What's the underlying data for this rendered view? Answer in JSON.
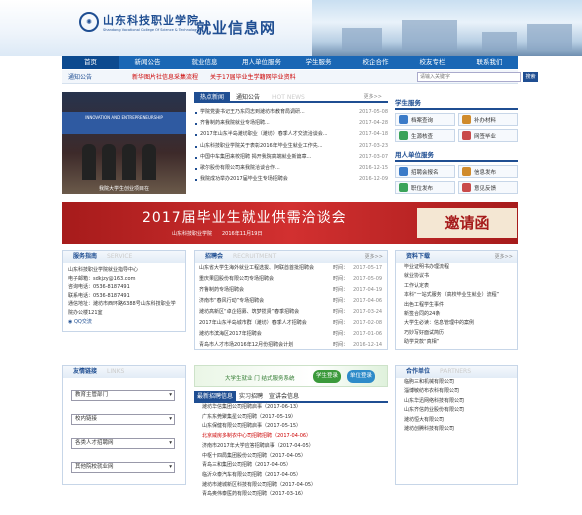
{
  "header": {
    "seal": "✺",
    "cn_name": "山东科技职业学院",
    "en_name": "Shandong Vocational College Of Science & Technology",
    "site_title": "就业信息网"
  },
  "nav": [
    "首页",
    "新闻公告",
    "就业信息",
    "用人单位服务",
    "学生服务",
    "校企合作",
    "校友专栏",
    "联系我们"
  ],
  "notice": {
    "label": "通知公告",
    "msg1": "新华图片社信息采集流程",
    "msg2": "关于17届毕业生学籍网毕业资料",
    "search_placeholder": "请输入关键字",
    "search_btn": "搜索"
  },
  "photo": {
    "band": "INNOVATION AND ENTREPRENEURSHIP",
    "caption": "我院大学生创业项目在"
  },
  "news": {
    "tabs": [
      "热点新闻",
      "通知公告",
      "HOT NEWS"
    ],
    "more": "更多>>",
    "items": [
      {
        "t": "学院党委书记王乃东同志到潍坊市教育局调研...",
        "d": "2017-05-08"
      },
      {
        "t": "齐鲁制药来我院就业专场招聘...",
        "d": "2017-04-28"
      },
      {
        "t": "2017年山东半岛潍坊职业（潍坊）春季人才交流洽谈会...",
        "d": "2017-04-18"
      },
      {
        "t": "山东科技职业学院关于表彰2016年毕业生就业工作先...",
        "d": "2017-03-23"
      },
      {
        "t": "中国中车集团来校招聘 揭开我院高端就业新篇章...",
        "d": "2017-03-07"
      },
      {
        "t": "歌尔股份有限公司来我院洽谈合作...",
        "d": "2016-12-15"
      },
      {
        "t": "我院成功举办2017届毕业生专场招聘会",
        "d": "2016-12-09"
      }
    ]
  },
  "services": {
    "student_title": "学生服务",
    "student": [
      "档案查询",
      "补办材料",
      "生源核查",
      "网签毕业"
    ],
    "employer_title": "用人单位服务",
    "employer": [
      "招聘会报名",
      "信息发布",
      "职位发布",
      "意见反馈"
    ]
  },
  "banner": {
    "title": "2017届毕业生就业供需洽谈会",
    "sub": "山东科技职业学院　　2016年11月19日",
    "invite": "邀请函"
  },
  "guide": {
    "title": "服务指南",
    "ghost": "SERVICE",
    "lines": [
      "山东科技职业学院就业指导中心",
      "电子邮箱：sdkjzy@163.com",
      "咨询电话：0536-8187491",
      "联系电话：0536-8187491",
      "通信地址：潍坊市西环路6388号山东科技职业学院办公楼121室"
    ],
    "qq": "QQ交流"
  },
  "recruit": {
    "title": "招聘会",
    "ghost": "RECRUITMENT",
    "more": "更多>>",
    "items": [
      {
        "t": "山东省大学生海外就业工程选拔、阿联酋首批招聘会",
        "d": "2017-05-17"
      },
      {
        "t": "重庆果园股份有限公司专场招聘会",
        "d": "2017-05-09"
      },
      {
        "t": "齐鲁制药专场招聘会",
        "d": "2017-04-19"
      },
      {
        "t": "济南市“春风行动”专场招聘会",
        "d": "2017-04-06"
      },
      {
        "t": "潍坊高新区“卓企招募、筑梦揽贤”春季招聘会",
        "d": "2017-03-24"
      },
      {
        "t": "2017年山东半岛城市群（潍坊）春季人才招聘会",
        "d": "2017-02-08"
      },
      {
        "t": "潍坊市滨海区2017年招聘会",
        "d": "2017-01-06"
      },
      {
        "t": "青岛市人才市场2016年12月份招聘会计划",
        "d": "2016-12-14"
      }
    ],
    "label_t": "时间："
  },
  "materials": {
    "title": "资料下载",
    "more": "更多>>",
    "items": [
      "毕业证明书办理流程",
      "就业协议书",
      "工作认定表",
      "本科“一站式服务（高校毕业生就业）流程”",
      "出色工程学生事件",
      "新签合同的24条",
      "大学生必读：信息管理中的案例",
      "巧妙写好面试简历",
      "助学贷款“真相”",
      "应届毕业生求职计划技巧"
    ]
  },
  "links": {
    "title": "友情链接",
    "ghost": "LINKS",
    "selects": [
      "教育主管部门",
      "校内链接",
      "各类人才招聘网",
      "其他院校就业网"
    ]
  },
  "sys": {
    "text": "大学生就业 门 结式服务系统",
    "login1": "学生登录",
    "login2": "单位登录"
  },
  "latest": {
    "tabs": [
      "最新招聘信息",
      "实习招聘",
      "宣讲会信息"
    ],
    "more": "更多>>",
    "items": [
      {
        "t": "潍坊华信集团公司招聘启事（2017-06-13）",
        "red": false
      },
      {
        "t": "广东东莞聚集星公司招聘（2017-05-19）",
        "red": false
      },
      {
        "t": "山东保健有限公司招聘启事（2017-05-15）",
        "red": false
      },
      {
        "t": "北京威房多制衣中心司招聘招聘（2017-04-06）",
        "red": true
      },
      {
        "t": "济南市2017年大学应答招聘启事（2017-04-05）",
        "red": false
      },
      {
        "t": "中枢十四局集团股份公司招聘（2017-04-05）",
        "red": false
      },
      {
        "t": "青岛三和集团公司招聘（2017-04-05）",
        "red": false
      },
      {
        "t": "临沂众泰汽车有限公司招聘（2017-04-05）",
        "red": false
      },
      {
        "t": "潍坊市潍城新区科技有限公司招聘（2017-04-05）",
        "red": false
      },
      {
        "t": "青岛奥伟泰医药有限公司招聘（2017-03-16）",
        "red": false
      }
    ]
  },
  "coop": {
    "title": "合作单位",
    "ghost": "PARTNERS",
    "items": [
      "临朐三和机械有限公司",
      "淄博敏纺布衣科有限公司",
      "山东华迅网络科技有限公司",
      "山东齐信药业股份有限公司",
      "潍坊恒大有限公司",
      "潍坊创腾科技有限公司"
    ]
  }
}
